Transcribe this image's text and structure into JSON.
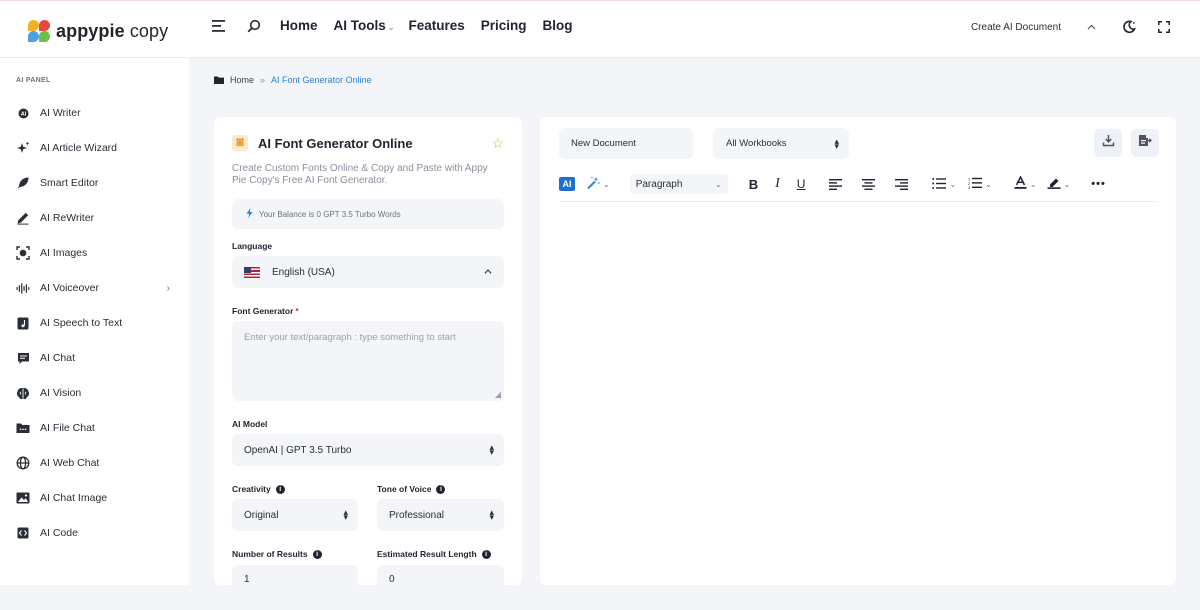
{
  "brand": {
    "name_bold": "appypie",
    "name_light": " copy",
    "colors": [
      "#f4b023",
      "#e8473e",
      "#4aa3df",
      "#6cc04a"
    ]
  },
  "nav": {
    "links": [
      {
        "label": "Home"
      },
      {
        "label": "AI Tools"
      },
      {
        "label": "Features"
      },
      {
        "label": "Pricing"
      },
      {
        "label": "Blog"
      }
    ],
    "create_doc": "Create AI Document"
  },
  "sidebar": {
    "panel_label": "AI PANEL",
    "items": [
      {
        "label": "AI Writer",
        "icon": "ai-writer-icon"
      },
      {
        "label": "AI Article Wizard",
        "icon": "sparkles-icon"
      },
      {
        "label": "Smart Editor",
        "icon": "feather-icon"
      },
      {
        "label": "AI ReWriter",
        "icon": "pencil-icon"
      },
      {
        "label": "AI Images",
        "icon": "image-scan-icon"
      },
      {
        "label": "AI Voiceover",
        "icon": "waveform-icon"
      },
      {
        "label": "AI Speech to Text",
        "icon": "speech-file-icon"
      },
      {
        "label": "AI Chat",
        "icon": "chat-icon"
      },
      {
        "label": "AI Vision",
        "icon": "brain-icon"
      },
      {
        "label": "AI File Chat",
        "icon": "folder-icon"
      },
      {
        "label": "AI Web Chat",
        "icon": "globe-icon"
      },
      {
        "label": "AI Chat Image",
        "icon": "picture-icon"
      },
      {
        "label": "AI Code",
        "icon": "code-icon"
      }
    ]
  },
  "breadcrumb": {
    "home": "Home",
    "sep": "»",
    "current": "AI Font Generator Online"
  },
  "form": {
    "title": "AI Font Generator Online",
    "description": "Create Custom Fonts Online & Copy and Paste with Appy Pie Copy's Free AI Font Generator.",
    "balance": "Your Balance is 0 GPT 3.5 Turbo Words",
    "language_label": "Language",
    "language_value": "English (USA)",
    "font_gen_label": "Font Generator",
    "font_gen_placeholder": "Enter your text/paragraph : type something to start",
    "model_label": "AI Model",
    "model_value": "OpenAI | GPT 3.5 Turbo",
    "creativity_label": "Creativity",
    "creativity_value": "Original",
    "tone_label": "Tone of Voice",
    "tone_value": "Professional",
    "results_label": "Number of Results",
    "results_value": "1",
    "length_label": "Estimated Result Length",
    "length_value": "0"
  },
  "editor": {
    "doc_name": "New Document",
    "workbook": "All Workbooks",
    "ai_badge": "AI",
    "paragraph": "Paragraph"
  }
}
